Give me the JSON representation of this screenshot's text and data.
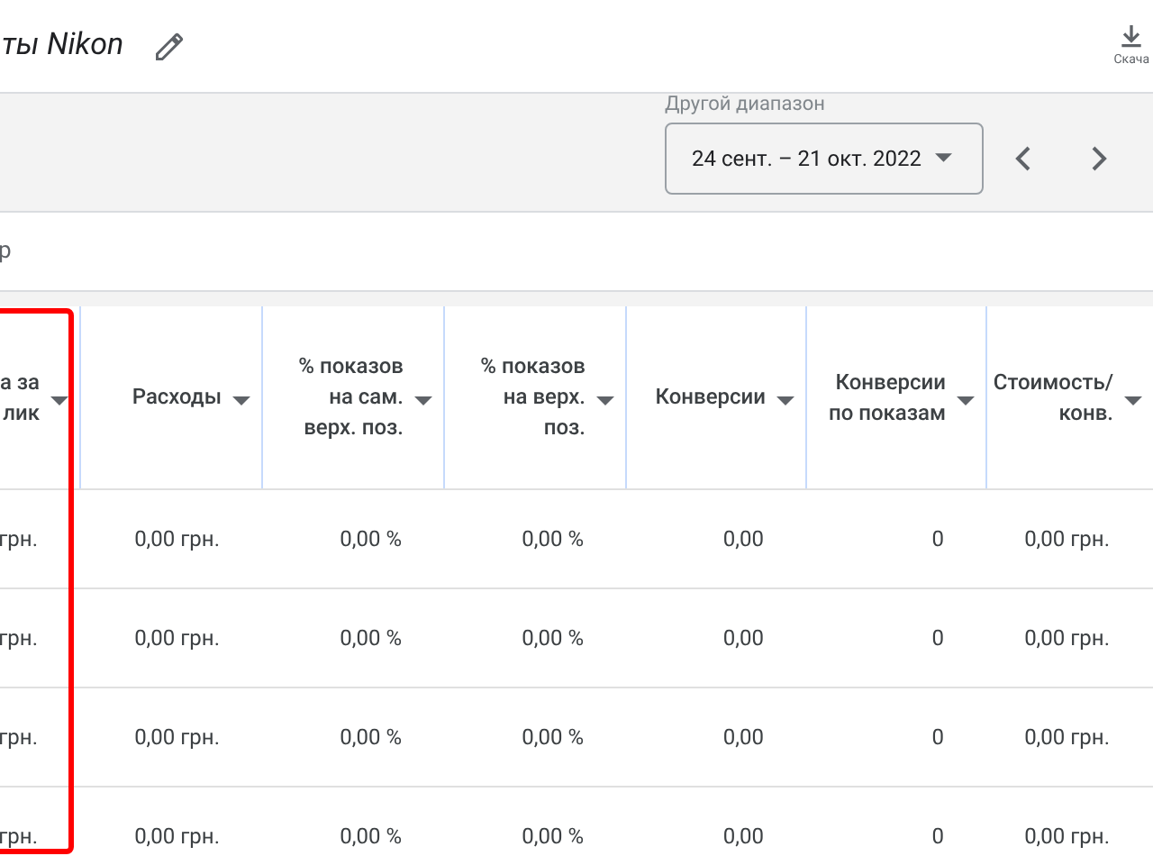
{
  "header": {
    "title": "ты Nikon",
    "download_label": "Скача"
  },
  "date_range": {
    "label": "Другой диапазон",
    "value": "24 сент. – 21 окт. 2022"
  },
  "filter": {
    "text": "р"
  },
  "table": {
    "columns": [
      {
        "label": "а за\nлик",
        "highlighted": true
      },
      {
        "label": "Расходы",
        "highlighted": false
      },
      {
        "label": "% показов\nна сам.\nверх. поз.",
        "highlighted": false
      },
      {
        "label": "% показов\nна верх.\nпоз.",
        "highlighted": false
      },
      {
        "label": "Конверсии",
        "highlighted": false
      },
      {
        "label": "Конверсии\nпо показам",
        "highlighted": false
      },
      {
        "label": "Стоимость/\nконв.",
        "highlighted": false
      }
    ],
    "rows": [
      [
        "грн.",
        "0,00 грн.",
        "0,00 %",
        "0,00 %",
        "0,00",
        "0",
        "0,00 грн."
      ],
      [
        "грн.",
        "0,00 грн.",
        "0,00 %",
        "0,00 %",
        "0,00",
        "0",
        "0,00 грн."
      ],
      [
        "грн.",
        "0,00 грн.",
        "0,00 %",
        "0,00 %",
        "0,00",
        "0",
        "0,00 грн."
      ],
      [
        "грн.",
        "0,00 грн.",
        "0,00 %",
        "0,00 %",
        "0,00",
        "0",
        "0,00 грн."
      ]
    ]
  }
}
